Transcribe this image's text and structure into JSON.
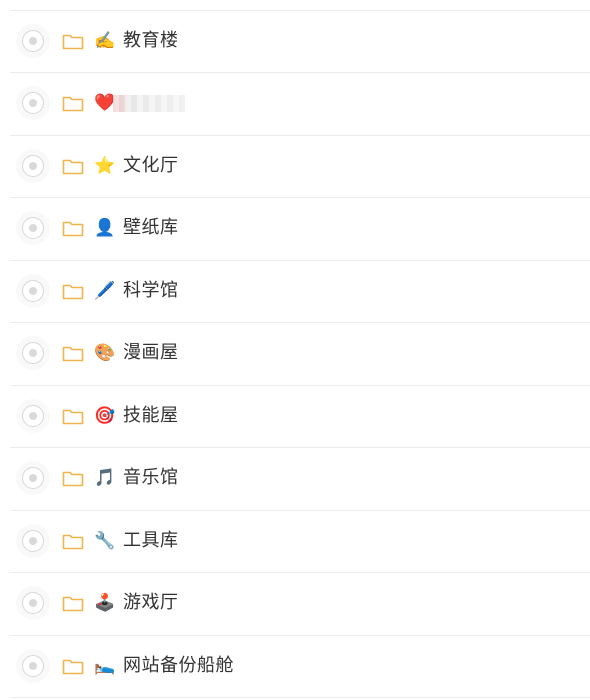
{
  "folder_icon_color": "#f0b44d",
  "rows": [
    {
      "emoji": "",
      "label": ""
    },
    {
      "emoji": "✍️",
      "label": "教育楼"
    },
    {
      "emoji": "❤️",
      "label": "",
      "obscured": true
    },
    {
      "emoji": "⭐",
      "label": "文化厅"
    },
    {
      "emoji": "👤",
      "label": "壁纸库"
    },
    {
      "emoji": "🖊️",
      "label": "科学馆"
    },
    {
      "emoji": "🎨",
      "label": "漫画屋"
    },
    {
      "emoji": "🎯",
      "label": "技能屋"
    },
    {
      "emoji": "🎵",
      "label": "音乐馆"
    },
    {
      "emoji": "🔧",
      "label": "工具库"
    },
    {
      "emoji": "🕹️",
      "label": "游戏厅"
    },
    {
      "emoji": "🛌",
      "label": "网站备份船舱"
    }
  ]
}
